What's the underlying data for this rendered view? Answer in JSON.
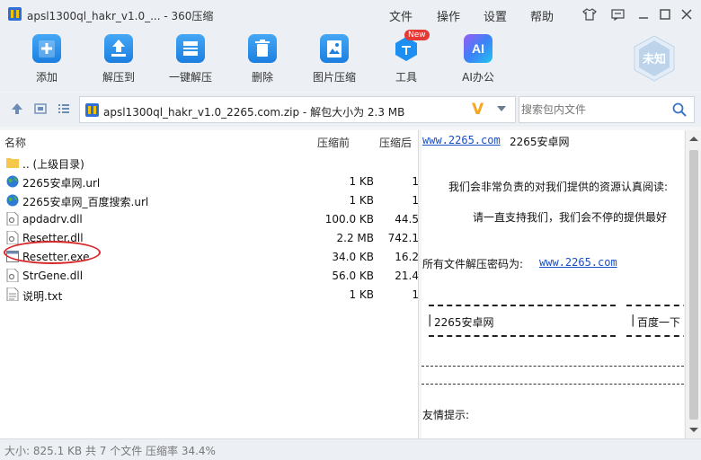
{
  "window": {
    "title": "apsl1300ql_hakr_v1.0_... - 360压缩",
    "menu": [
      "文件",
      "操作",
      "设置",
      "帮助"
    ]
  },
  "toolbar": {
    "items": [
      {
        "label": "添加",
        "icon": "add-icon"
      },
      {
        "label": "解压到",
        "icon": "extract-to-icon"
      },
      {
        "label": "一键解压",
        "icon": "one-click-extract-icon"
      },
      {
        "label": "删除",
        "icon": "delete-icon"
      },
      {
        "label": "图片压缩",
        "icon": "image-compress-icon"
      },
      {
        "label": "工具",
        "icon": "tools-icon",
        "badge": "New"
      },
      {
        "label": "AI办公",
        "icon": "ai-office-icon",
        "icon_text": "AI"
      }
    ],
    "shield_label": "未知"
  },
  "address": {
    "path": "apsl1300ql_hakr_v1.0_2265.com.zip - 解包大小为 2.3 MB",
    "v_logo": "V"
  },
  "search": {
    "placeholder": "搜索包内文件"
  },
  "list": {
    "headers": {
      "name": "名称",
      "compressed": "压缩前",
      "after": "压缩后"
    },
    "rows": [
      {
        "name": ".. (上级目录)",
        "before": "",
        "after": "",
        "icon": "folder-icon"
      },
      {
        "name": "2265安卓网.url",
        "before": "1 KB",
        "after": "1",
        "icon": "globe-icon"
      },
      {
        "name": "2265安卓网_百度搜索.url",
        "before": "1 KB",
        "after": "1",
        "icon": "globe-icon"
      },
      {
        "name": "apdadrv.dll",
        "before": "100.0 KB",
        "after": "44.5",
        "icon": "dll-file-icon"
      },
      {
        "name": "Resetter.dll",
        "before": "2.2 MB",
        "after": "742.1",
        "icon": "dll-file-icon"
      },
      {
        "name": "Resetter.exe",
        "before": "34.0 KB",
        "after": "16.2",
        "icon": "exe-file-icon"
      },
      {
        "name": "StrGene.dll",
        "before": "56.0 KB",
        "after": "21.4",
        "icon": "dll-file-icon"
      },
      {
        "name": "说明.txt",
        "before": "1 KB",
        "after": "1",
        "icon": "txt-file-icon"
      }
    ]
  },
  "preview": {
    "line1_link": "www.2265.com",
    "line1_site": "2265安卓网",
    "line2": "我们会非常负责的对我们提供的资源认真阅读:",
    "line3": "请一直支持我们，我们会不停的提供最好",
    "line4_text": "所有文件解压密码为:",
    "line4_link": "www.2265.com",
    "box1": "2265安卓网",
    "box2": "百度一下",
    "tip": "友情提示:"
  },
  "status": {
    "text": "大小: 825.1 KB 共 7 个文件 压缩率 34.4%"
  }
}
